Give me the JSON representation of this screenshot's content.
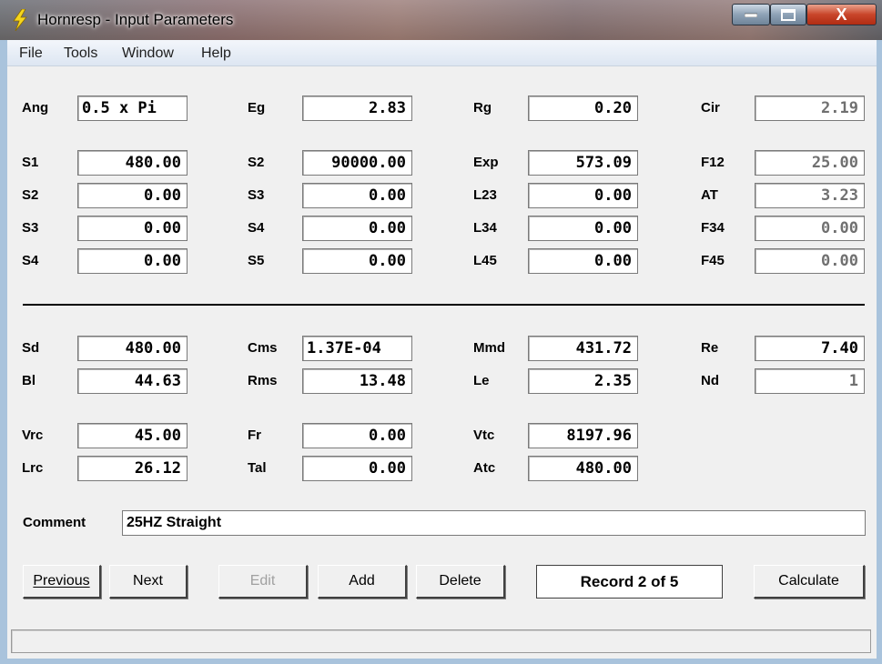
{
  "window": {
    "title": "Hornresp - Input Parameters",
    "close_glyph": "X"
  },
  "menu": [
    "File",
    "Tools",
    "Window",
    "Help"
  ],
  "params": {
    "Ang": "0.5 x Pi",
    "Eg": "2.83",
    "Rg": "0.20",
    "Cir": "2.19",
    "S1": "480.00",
    "S2a": "90000.00",
    "Exp": "573.09",
    "F12": "25.00",
    "S2": "0.00",
    "S3a": "0.00",
    "L23": "0.00",
    "AT": "3.23",
    "S3": "0.00",
    "S4a": "0.00",
    "L34": "0.00",
    "F34": "0.00",
    "S4": "0.00",
    "S5": "0.00",
    "L45": "0.00",
    "F45": "0.00",
    "Sd": "480.00",
    "Cms": "1.37E-04",
    "Mmd": "431.72",
    "Re": "7.40",
    "Bl": "44.63",
    "Rms": "13.48",
    "Le": "2.35",
    "Nd": "1",
    "Vrc": "45.00",
    "Fr": "0.00",
    "Vtc": "8197.96",
    "Lrc": "26.12",
    "Tal": "0.00",
    "Atc": "480.00"
  },
  "labels": {
    "Ang": "Ang",
    "Eg": "Eg",
    "Rg": "Rg",
    "Cir": "Cir",
    "S1": "S1",
    "S2a": "S2",
    "Exp": "Exp",
    "F12": "F12",
    "S2": "S2",
    "S3a": "S3",
    "L23": "L23",
    "AT": "AT",
    "S3": "S3",
    "S4a": "S4",
    "L34": "L34",
    "F34": "F34",
    "S4": "S4",
    "S5": "S5",
    "L45": "L45",
    "F45": "F45",
    "Sd": "Sd",
    "Cms": "Cms",
    "Mmd": "Mmd",
    "Re": "Re",
    "Bl": "Bl",
    "Rms": "Rms",
    "Le": "Le",
    "Nd": "Nd",
    "Vrc": "Vrc",
    "Fr": "Fr",
    "Vtc": "Vtc",
    "Lrc": "Lrc",
    "Tal": "Tal",
    "Atc": "Atc"
  },
  "comment": {
    "label": "Comment",
    "value": "25HZ Straight"
  },
  "buttons": {
    "previous": "Previous",
    "next": "Next",
    "edit": "Edit",
    "add": "Add",
    "delete": "Delete",
    "calculate": "Calculate"
  },
  "record": "Record 2 of 5"
}
